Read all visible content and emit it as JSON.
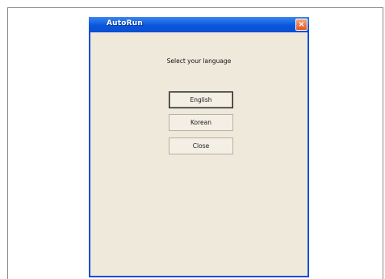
{
  "window": {
    "title": "AutoRun",
    "close_glyph": "×",
    "close_icon": "close-icon"
  },
  "content": {
    "prompt": "Select your language"
  },
  "buttons": {
    "english": "English",
    "korean": "Korean",
    "close": "Close"
  },
  "colors": {
    "titlebar": "#0a56de",
    "window_bg": "#efe9dc",
    "close_button": "#e35a1f"
  }
}
